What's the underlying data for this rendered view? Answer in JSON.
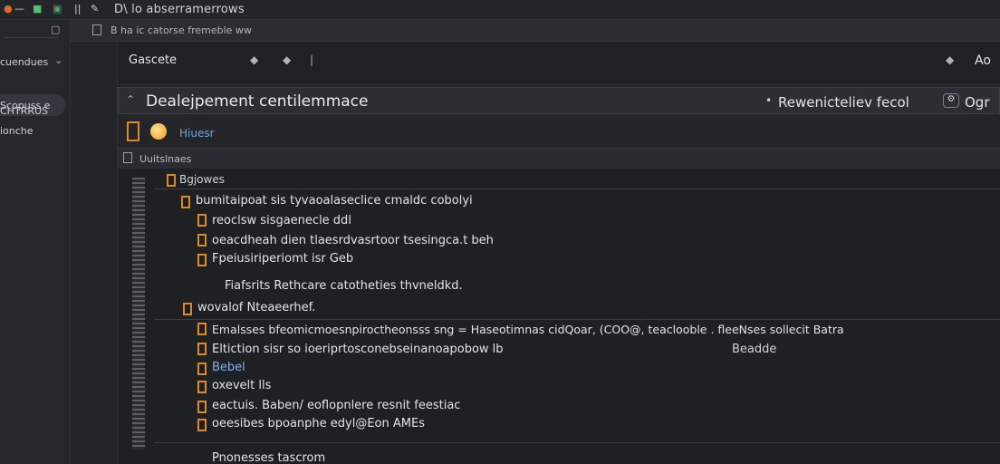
{
  "window": {
    "title": "D\\ lo abserramerrows"
  },
  "toolbar": {
    "path_text": "B  ha ic catorse fremeble ww"
  },
  "sidebar": {
    "items": [
      {
        "label": "cuendues"
      },
      {
        "label": "Scopuss e"
      },
      {
        "label": "CHTRRUS"
      },
      {
        "label": "ionche"
      }
    ]
  },
  "breadcrumb": {
    "label": "Gascete",
    "right_label": "Ao"
  },
  "panel": {
    "title": "Dealejpement centilemmace",
    "right_text": "Rewenicteliev fecol",
    "right_extra": "Ogr"
  },
  "subheader": {
    "files_label": "Hiuesr"
  },
  "section": {
    "label": "Uuitslnaes"
  },
  "code": {
    "header": "Bgjowes",
    "lines": [
      "bumitaipoat sis tyvaoalaseclice cmaldc cobolyi",
      "reoclsw  sisgaenecle ddl",
      "oeacdheah dien tlaesrdvasrtoor    tsesingca.t beh",
      "Fpeiusiriperiomt  isr  Geb",
      "Fiafsrits Rethcare catotheties thvneldkd.",
      "wovalof  Nteaeerhef.",
      "Emalsses bfeomicmoesnpiroctheonsss sng = Haseotimnas cidQoar,  (COO@,  teaclooble .  fleeNses     sollecit    Batra",
      "Eltiction  sisr  so  ioeriprtosconebseinanoapobow  lb",
      "Beadde",
      "Bebel",
      "oxevelt lls",
      "eactuis.  Baben/ eoflopnlere  resnit feestiac",
      "oeesibes  bpoanphe edyl@Eon AMEs",
      "Pnonesses  tascrom"
    ]
  }
}
